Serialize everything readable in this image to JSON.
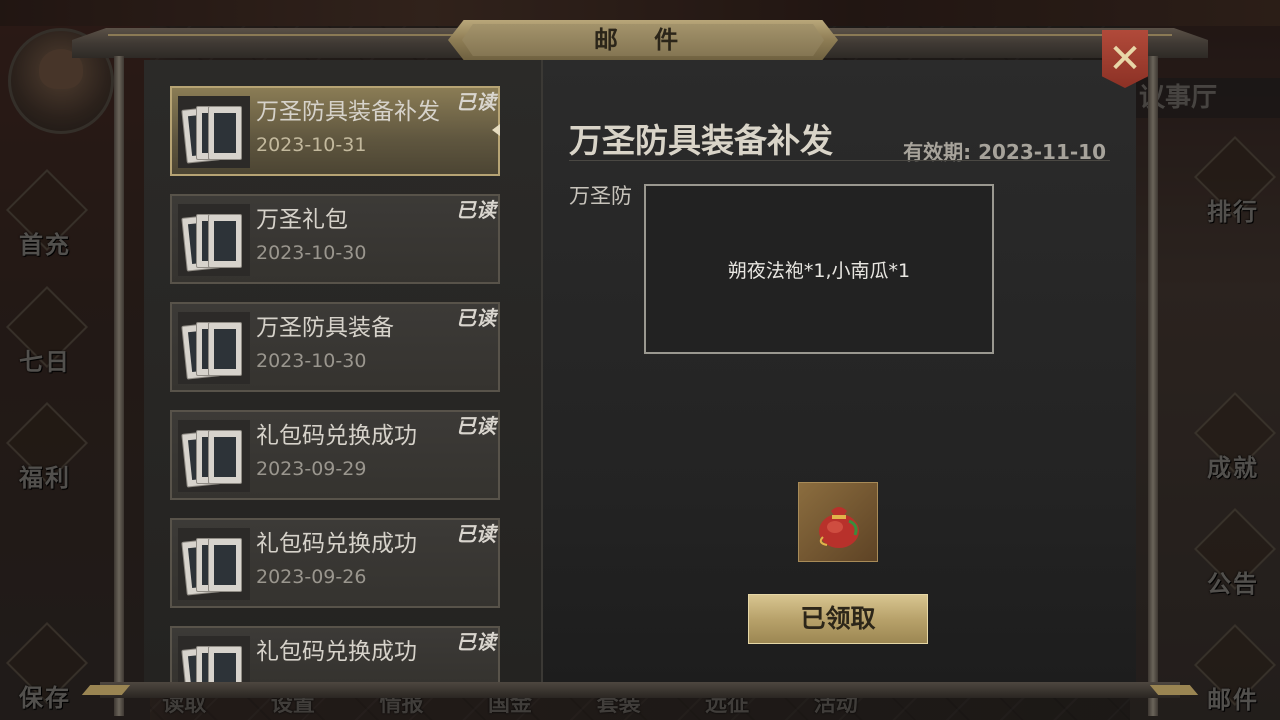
{
  "window_title": "邮 件",
  "close_label": "✕",
  "side_left": [
    "首充",
    "七日",
    "福利",
    "保存"
  ],
  "side_right": [
    "排行",
    "成就",
    "公告",
    "邮件"
  ],
  "hall_label": "议事厅",
  "bottom_menu": [
    "读取",
    "设置",
    "情报",
    "国金",
    "套装",
    "远征",
    "活动"
  ],
  "mail_list": [
    {
      "title": "万圣防具装备补发",
      "date": "2023-10-31",
      "status": "已读",
      "selected": true
    },
    {
      "title": "万圣礼包",
      "date": "2023-10-30",
      "status": "已读",
      "selected": false
    },
    {
      "title": "万圣防具装备",
      "date": "2023-10-30",
      "status": "已读",
      "selected": false
    },
    {
      "title": "礼包码兑换成功",
      "date": "2023-09-29",
      "status": "已读",
      "selected": false
    },
    {
      "title": "礼包码兑换成功",
      "date": "2023-09-26",
      "status": "已读",
      "selected": false
    },
    {
      "title": "礼包码兑换成功",
      "date": "",
      "status": "已读",
      "selected": false
    }
  ],
  "detail": {
    "title": "万圣防具装备补发",
    "expiry": "有效期: 2023-11-10",
    "body_partial": "万圣防",
    "tooltip": "朔夜法袍*1,小南瓜*1",
    "reward_icon": "red-pumpkin-bag-icon",
    "claim_label": "已领取"
  },
  "colors": {
    "selected_item": "#8a7c55",
    "claim_button": "#c8b47e",
    "close_button": "#a84233"
  }
}
